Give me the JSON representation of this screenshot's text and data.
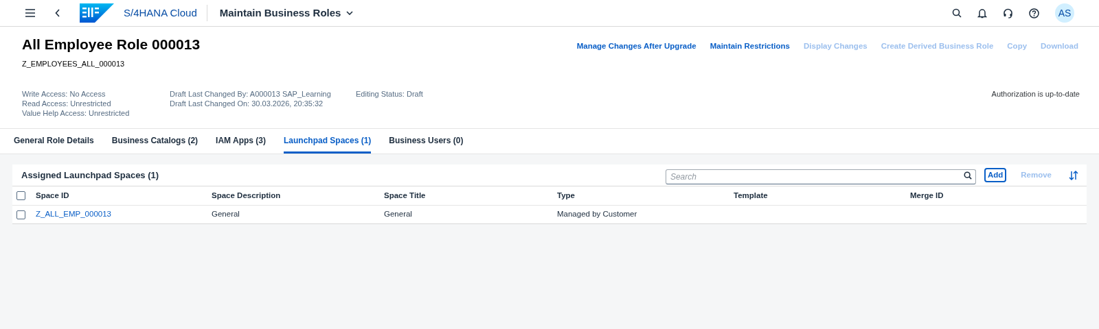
{
  "shell": {
    "product": "S/4HANA Cloud",
    "app_title": "Maintain Business Roles",
    "avatar": "AS"
  },
  "header": {
    "title": "All Employee Role 000013",
    "subtitle": "Z_EMPLOYEES_ALL_000013",
    "actions": [
      {
        "label": "Manage Changes After Upgrade",
        "disabled": false
      },
      {
        "label": "Maintain Restrictions",
        "disabled": false
      },
      {
        "label": "Display Changes",
        "disabled": true
      },
      {
        "label": "Create Derived Business Role",
        "disabled": true
      },
      {
        "label": "Copy",
        "disabled": true
      },
      {
        "label": "Download",
        "disabled": true
      }
    ],
    "info_columns": [
      [
        "Write Access: No Access",
        "Read Access: Unrestricted",
        "Value Help Access: Unrestricted"
      ],
      [
        "Draft Last Changed By: A000013 SAP_Learning",
        "Draft Last Changed On: 30.03.2026, 20:35:32"
      ],
      [
        "Editing Status: Draft"
      ]
    ],
    "status": "Authorization is up-to-date"
  },
  "tabs": [
    {
      "label": "General Role Details",
      "selected": false
    },
    {
      "label": "Business Catalogs (2)",
      "selected": false
    },
    {
      "label": "IAM Apps (3)",
      "selected": false
    },
    {
      "label": "Launchpad Spaces (1)",
      "selected": true
    },
    {
      "label": "Business Users (0)",
      "selected": false
    }
  ],
  "table": {
    "title": "Assigned Launchpad Spaces (1)",
    "select_all_checked": false,
    "search": {
      "placeholder": "Search"
    },
    "buttons": [
      {
        "label": "Add",
        "disabled": false
      },
      {
        "label": "Remove",
        "disabled": true
      }
    ],
    "columns": [
      "Space ID",
      "Space Description",
      "Space Title",
      "Type",
      "Template",
      "Merge ID"
    ],
    "rows": [
      {
        "checked": false,
        "cells": [
          "Z_ALL_EMP_000013",
          "General",
          "General",
          "Managed by Customer",
          "",
          ""
        ]
      }
    ]
  }
}
